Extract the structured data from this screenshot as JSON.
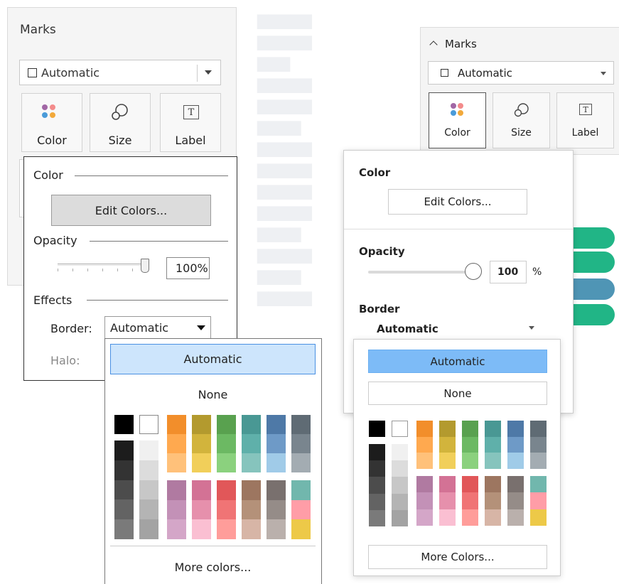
{
  "left": {
    "marks_title": "Marks",
    "mark_type": "Automatic",
    "buttons": {
      "color": "Color",
      "size": "Size",
      "label": "Label"
    },
    "popup": {
      "color_heading": "Color",
      "edit_colors": "Edit Colors...",
      "opacity_heading": "Opacity",
      "opacity_value": "100%",
      "effects_heading": "Effects",
      "border_label": "Border:",
      "border_value": "Automatic",
      "halo_label": "Halo:"
    },
    "dropdown": {
      "automatic": "Automatic",
      "none": "None",
      "more": "More colors..."
    }
  },
  "right": {
    "marks_title": "Marks",
    "mark_type": "Automatic",
    "buttons": {
      "color": "Color",
      "size": "Size",
      "label": "Label"
    },
    "popup": {
      "color_heading": "Color",
      "edit_colors": "Edit Colors...",
      "opacity_heading": "Opacity",
      "opacity_value": "100",
      "opacity_unit": "%",
      "border_heading": "Border",
      "border_value": "Automatic"
    },
    "dropdown": {
      "automatic": "Automatic",
      "none": "None",
      "more": "More Colors..."
    }
  },
  "opacity_percent": 100,
  "colors": {
    "orange": [
      "#f28e2b",
      "#ffa94f",
      "#ffc17a"
    ],
    "olive": [
      "#b39a2e",
      "#d2b43c",
      "#f1cf5a"
    ],
    "green": [
      "#59a14f",
      "#6cb963",
      "#8bd17e"
    ],
    "teal": [
      "#499894",
      "#5fb0aa",
      "#86c4bd"
    ],
    "blue": [
      "#4e79a7",
      "#6e9ac7",
      "#a0cbe8"
    ],
    "slate": [
      "#5f6b74",
      "#79858e",
      "#a3acb2"
    ],
    "purple": [
      "#b07aa1",
      "#c391b7",
      "#d4a6c8"
    ],
    "pink": [
      "#d37295",
      "#e690ac",
      "#fabfd2"
    ],
    "red": [
      "#e15759",
      "#f07475",
      "#ff9d9a"
    ],
    "brown": [
      "#9d7660",
      "#b49179",
      "#d7b5a6"
    ],
    "taupe": [
      "#79706e",
      "#958c88",
      "#bab0ac"
    ],
    "misc": [
      "#71b7ad",
      "#ff9da7",
      "#edc948"
    ],
    "dark_grays": [
      "#1c1c1c",
      "#333333",
      "#4c4c4c",
      "#636363",
      "#7a7a7a"
    ],
    "light_grays": [
      "#f0f0f0",
      "#dcdcdc",
      "#c7c7c7",
      "#b4b4b4",
      "#a3a3a3"
    ]
  }
}
